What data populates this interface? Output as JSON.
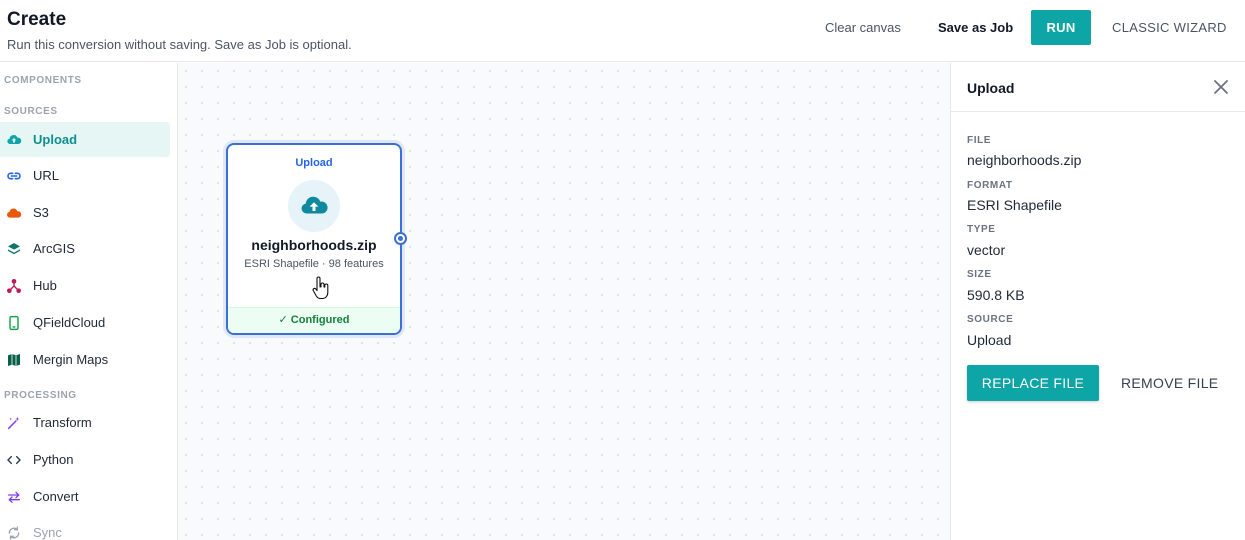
{
  "header": {
    "title": "Create",
    "subtitle": "Run this conversion without saving. Save as Job is optional.",
    "clear_label": "Clear canvas",
    "save_label": "Save as Job",
    "run_label": "RUN",
    "classic_label": "CLASSIC WIZARD"
  },
  "sidebar": {
    "components_heading": "COMPONENTS",
    "sources_heading": "SOURCES",
    "processing_heading": "PROCESSING",
    "sources": [
      {
        "label": "Upload",
        "icon": "cloud-upload-icon",
        "color": "#0ea5a6",
        "active": true
      },
      {
        "label": "URL",
        "icon": "link-icon",
        "color": "#2563eb"
      },
      {
        "label": "S3",
        "icon": "cloud-icon",
        "color": "#ea580c"
      },
      {
        "label": "ArcGIS",
        "icon": "layers-icon",
        "color": "#0f766e"
      },
      {
        "label": "Hub",
        "icon": "hub-icon",
        "color": "#be185d"
      },
      {
        "label": "QFieldCloud",
        "icon": "mobile-icon",
        "color": "#16a34a"
      },
      {
        "label": "Mergin Maps",
        "icon": "map-icon",
        "color": "#065f46"
      }
    ],
    "processing": [
      {
        "label": "Transform",
        "icon": "magic-wand-icon",
        "color": "#7c3aed"
      },
      {
        "label": "Python",
        "icon": "code-icon",
        "color": "#334155"
      },
      {
        "label": "Convert",
        "icon": "swap-icon",
        "color": "#7c3aed"
      },
      {
        "label": "Sync",
        "icon": "sync-icon",
        "color": "#9ca3af",
        "disabled": true
      }
    ]
  },
  "node": {
    "type": "Upload",
    "name": "neighborhoods.zip",
    "meta": "ESRI Shapefile · 98 features",
    "status": "✓ Configured"
  },
  "panel": {
    "title": "Upload",
    "file_label": "FILE",
    "file_value": "neighborhoods.zip",
    "format_label": "FORMAT",
    "format_value": "ESRI Shapefile",
    "type_label": "TYPE",
    "type_value": "vector",
    "size_label": "SIZE",
    "size_value": "590.8 KB",
    "source_label": "SOURCE",
    "source_value": "Upload",
    "replace_label": "REPLACE FILE",
    "remove_label": "REMOVE FILE"
  },
  "colors": {
    "accent": "#0ea5a6",
    "node_border": "#3b6fd8",
    "configured": "#15803d"
  }
}
